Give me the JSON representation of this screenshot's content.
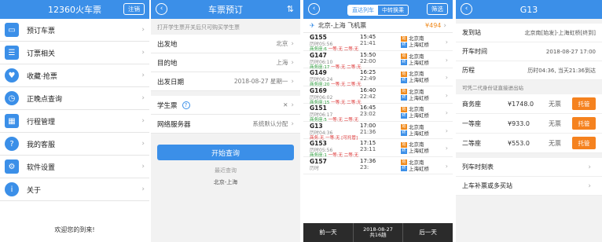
{
  "s1": {
    "title": "12360火车票",
    "logout": "注销",
    "menu": [
      {
        "label": "预订车票",
        "icon": "ticket-icon",
        "glyph": "▭"
      },
      {
        "label": "订票相关",
        "icon": "list-icon",
        "glyph": "☰"
      },
      {
        "label": "收藏·抢票",
        "icon": "heart-icon",
        "glyph": "♥"
      },
      {
        "label": "正晚点查询",
        "icon": "clock-icon",
        "glyph": "◷"
      },
      {
        "label": "行程管理",
        "icon": "grid-icon",
        "glyph": "▦"
      },
      {
        "label": "我的客服",
        "icon": "question-icon",
        "glyph": "?"
      },
      {
        "label": "软件设置",
        "icon": "gear-icon",
        "glyph": "⚙"
      },
      {
        "label": "关于",
        "icon": "info-icon",
        "glyph": "i"
      }
    ],
    "welcome": "欢迎您的到来!"
  },
  "s2": {
    "title": "车票预订",
    "hint": "打开学生票开关后只可购买学生票",
    "fields": {
      "from_label": "出发地",
      "from_val": "北京",
      "to_label": "目的地",
      "to_val": "上海",
      "date_label": "出发日期",
      "date_val": "2018-08-27 星期一",
      "student_label": "学生票",
      "server_label": "网络服务器",
      "server_val": "系统默认分配"
    },
    "search_btn": "开始查询",
    "recent_title": "最近查询",
    "recent_item": "北京-上海"
  },
  "s3": {
    "tab_train": "直达列车",
    "tab_transfer": "中转换乘",
    "filter": "筛选",
    "plane_label": "北京-上海 飞机票",
    "plane_price": "¥494",
    "trains": [
      {
        "no": "G155",
        "dur": "历时05:56",
        "dep": "15:45",
        "arr": "21:41",
        "from": "北京南",
        "to": "上海虹桥",
        "biz": "商务座:6",
        "first": "一等:无",
        "second": "二等:无"
      },
      {
        "no": "G147",
        "dur": "历时06:10",
        "dep": "15:50",
        "arr": "22:00",
        "from": "北京南",
        "to": "上海虹桥",
        "biz": "商务座:17",
        "first": "一等:无",
        "second": "二等:无"
      },
      {
        "no": "G149",
        "dur": "历时06:24",
        "dep": "16:25",
        "arr": "22:49",
        "from": "北京南",
        "to": "上海虹桥",
        "biz": "商务座:20",
        "first": "一等:无",
        "second": "二等:无"
      },
      {
        "no": "G169",
        "dur": "历时06:02",
        "dep": "16:40",
        "arr": "22:42",
        "from": "北京南",
        "to": "上海虹桥",
        "biz": "商务座:15",
        "first": "一等:无",
        "second": "二等:无"
      },
      {
        "no": "G151",
        "dur": "历时06:17",
        "dep": "16:45",
        "arr": "23:02",
        "from": "北京南",
        "to": "上海虹桥",
        "biz": "商务座:5",
        "first": "一等:无",
        "second": "二等:无"
      },
      {
        "no": "G13",
        "dur": "历时04:36",
        "dep": "17:00",
        "arr": "21:36",
        "from": "北京南",
        "to": "上海虹桥",
        "biz": "商务:无",
        "first": "一等:无",
        "second": "[可托管]"
      },
      {
        "no": "G153",
        "dur": "历时05:56",
        "dep": "17:15",
        "arr": "23:11",
        "from": "北京南",
        "to": "上海虹桥",
        "biz": "商务座:1",
        "first": "一等:无",
        "second": "二等:无"
      },
      {
        "no": "G157",
        "dur": "历时",
        "dep": "17:36",
        "arr": "23:",
        "from": "北京南",
        "to": "上海虹桥",
        "biz": "",
        "first": "",
        "second": ""
      }
    ],
    "prev": "前一天",
    "cur_date": "2018-08-27",
    "count": "共16趟",
    "next": "后一天"
  },
  "s4": {
    "title": "G13",
    "from_label": "发到站",
    "from_val": "北京南[始发]-上海虹桥[终到]",
    "time_label": "开车时间",
    "time_val": "2018-08-27 17:00",
    "dur_label": "历程",
    "dur_val": "历时04:36, 当天21:36到达",
    "note": "可凭二代身份证直接进出站",
    "seats": [
      {
        "name": "商务座",
        "price": "¥1748.0",
        "avail": "无票",
        "btn": "托管"
      },
      {
        "name": "一等座",
        "price": "¥933.0",
        "avail": "无票",
        "btn": "托管"
      },
      {
        "name": "二等座",
        "price": "¥553.0",
        "avail": "无票",
        "btn": "托管"
      }
    ],
    "timetable": "列车时刻表",
    "board": "上车补票或多买站"
  },
  "colors": {
    "accent": "#3b8fe8",
    "orange": "#f5821f"
  }
}
